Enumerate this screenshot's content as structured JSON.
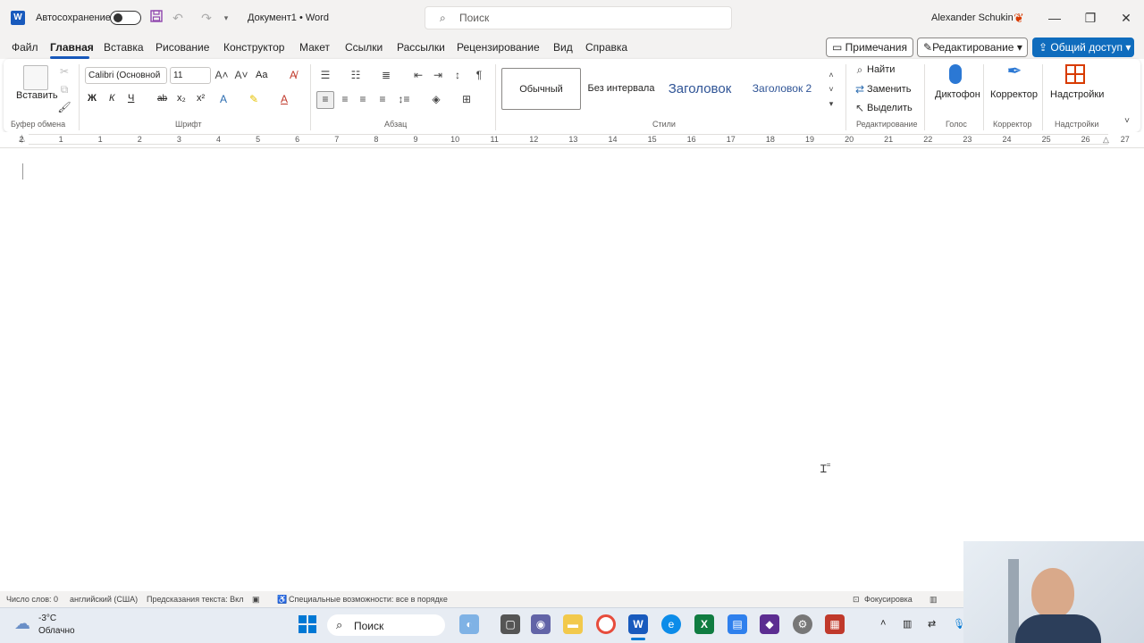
{
  "title_bar": {
    "app_logo": "W",
    "autosave_label": "Автосохранение",
    "document_title": "Документ1 • Word",
    "search_placeholder": "Поиск",
    "user_name": "Alexander Schukin",
    "icons": [
      "save-icon",
      "undo-icon",
      "redo-icon",
      "customize-icon",
      "search-icon",
      "minimize-icon",
      "restore-icon",
      "close-icon"
    ]
  },
  "menu": {
    "tabs": [
      "Файл",
      "Главная",
      "Вставка",
      "Рисование",
      "Конструктор",
      "Макет",
      "Ссылки",
      "Рассылки",
      "Рецензирование",
      "Вид",
      "Справка"
    ],
    "active_tab": "Главная",
    "comments_label": "Примечания",
    "editing_label": "Редактирование",
    "share_label": "Общий доступ"
  },
  "ribbon": {
    "clipboard": {
      "paste_label": "Вставить",
      "group_label": "Буфер обмена"
    },
    "font": {
      "font_name": "Calibri (Основной",
      "font_size": "11",
      "case_label": "Aa",
      "bold": "Ж",
      "italic": "К",
      "underline": "Ч",
      "strike": "ab",
      "subscript": "x₂",
      "superscript": "x²",
      "group_label": "Шрифт"
    },
    "paragraph": {
      "group_label": "Абзац"
    },
    "styles": {
      "items": [
        "Обычный",
        "Без интервала",
        "Заголовок",
        "Заголовок 2"
      ],
      "group_label": "Стили"
    },
    "editing": {
      "find_label": "Найти",
      "replace_label": "Заменить",
      "select_label": "Выделить",
      "group_label": "Редактирование"
    },
    "voice": {
      "dictate_label": "Диктофон",
      "group_label": "Голос"
    },
    "editor": {
      "editor_label": "Корректор",
      "group_label": "Корректор"
    },
    "addins": {
      "addins_label": "Надстройки",
      "group_label": "Надстройки"
    }
  },
  "ruler": {
    "numbers": [
      "2",
      "1",
      "1",
      "2",
      "3",
      "4",
      "5",
      "6",
      "7",
      "8",
      "9",
      "10",
      "11",
      "12",
      "13",
      "14",
      "15",
      "16",
      "17",
      "18",
      "19",
      "20",
      "21",
      "22",
      "23",
      "24",
      "25",
      "26",
      "27"
    ]
  },
  "status_bar": {
    "word_count": "Число слов: 0",
    "language": "английский (США)",
    "text_predictions": "Предсказания текста: Вкл",
    "accessibility": "Специальные возможности: все в порядке",
    "focus": "Фокусировка"
  },
  "taskbar": {
    "weather_temp": "-3°C",
    "weather_desc": "Облачно",
    "search_label": "Поиск"
  }
}
